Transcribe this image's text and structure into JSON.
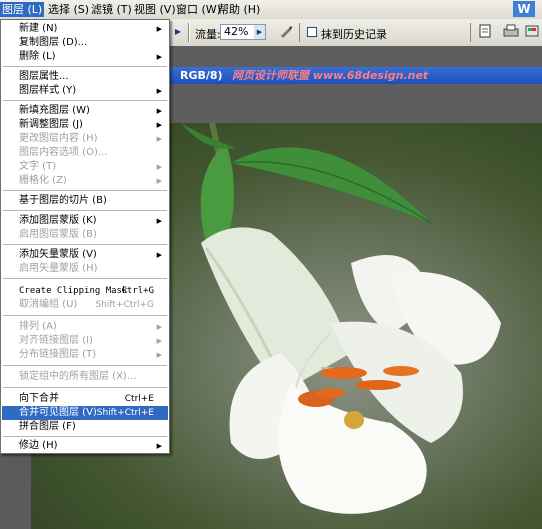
{
  "menubar": {
    "items": [
      {
        "label": "图层 (L)",
        "active": true
      },
      {
        "label": "选择 (S)"
      },
      {
        "label": "滤镜 (T)"
      },
      {
        "label": "视图 (V)"
      },
      {
        "label": "窗口 (W)"
      },
      {
        "label": "帮助 (H)"
      }
    ],
    "brand_text": "W"
  },
  "options": {
    "flow_label": "流量:",
    "flow_value": "42%",
    "history_label": "抹到历史记录"
  },
  "document": {
    "title_mode": "RGB/8)",
    "title_watermark": "网页设计师联盟 www.68design.net"
  },
  "menu": {
    "items": [
      {
        "label": "新建 (N)",
        "arrow": true
      },
      {
        "label": "复制图层 (D)...",
        "arrow": false
      },
      {
        "label": "删除 (L)",
        "arrow": true
      },
      {
        "sep": true
      },
      {
        "label": "图层属性...",
        "arrow": false
      },
      {
        "label": "图层样式 (Y)",
        "arrow": true
      },
      {
        "sep": true
      },
      {
        "label": "新填充图层 (W)",
        "arrow": true
      },
      {
        "label": "新调整图层 (J)",
        "arrow": true
      },
      {
        "label": "更改图层内容 (H)",
        "arrow": true,
        "disabled": true
      },
      {
        "label": "图层内容选项 (O)...",
        "arrow": false,
        "disabled": true
      },
      {
        "label": "文字 (T)",
        "arrow": true,
        "disabled": true
      },
      {
        "label": "栅格化 (Z)",
        "arrow": true,
        "disabled": true
      },
      {
        "sep": true
      },
      {
        "label": "基于图层的切片 (B)",
        "arrow": false
      },
      {
        "sep": true
      },
      {
        "label": "添加图层蒙版 (K)",
        "arrow": true
      },
      {
        "label": "启用图层蒙版 (B)",
        "arrow": false,
        "disabled": true
      },
      {
        "sep": true
      },
      {
        "label": "添加矢量蒙版 (V)",
        "arrow": true
      },
      {
        "label": "启用矢量蒙版 (H)",
        "arrow": false,
        "disabled": true
      },
      {
        "sep": true
      },
      {
        "label": "Create Clipping Mask",
        "shortcut": "Ctrl+G",
        "mono": true
      },
      {
        "label": "取消编组 (U)",
        "shortcut": "Shift+Ctrl+G",
        "disabled": true
      },
      {
        "sep": true
      },
      {
        "label": "排列 (A)",
        "arrow": true,
        "disabled": true
      },
      {
        "label": "对齐链接图层 (I)",
        "arrow": true,
        "disabled": true
      },
      {
        "label": "分布链接图层 (T)",
        "arrow": true,
        "disabled": true
      },
      {
        "sep": true
      },
      {
        "label": "锁定组中的所有图层 (X)...",
        "arrow": false,
        "disabled": true
      },
      {
        "sep": true
      },
      {
        "label": "向下合并",
        "shortcut": "Ctrl+E"
      },
      {
        "label": "合并可见图层 (V)",
        "shortcut": "Shift+Ctrl+E",
        "highlighted": true
      },
      {
        "label": "拼合图层 (F)"
      },
      {
        "sep": true
      },
      {
        "label": "修边 (H)",
        "arrow": true
      }
    ]
  }
}
